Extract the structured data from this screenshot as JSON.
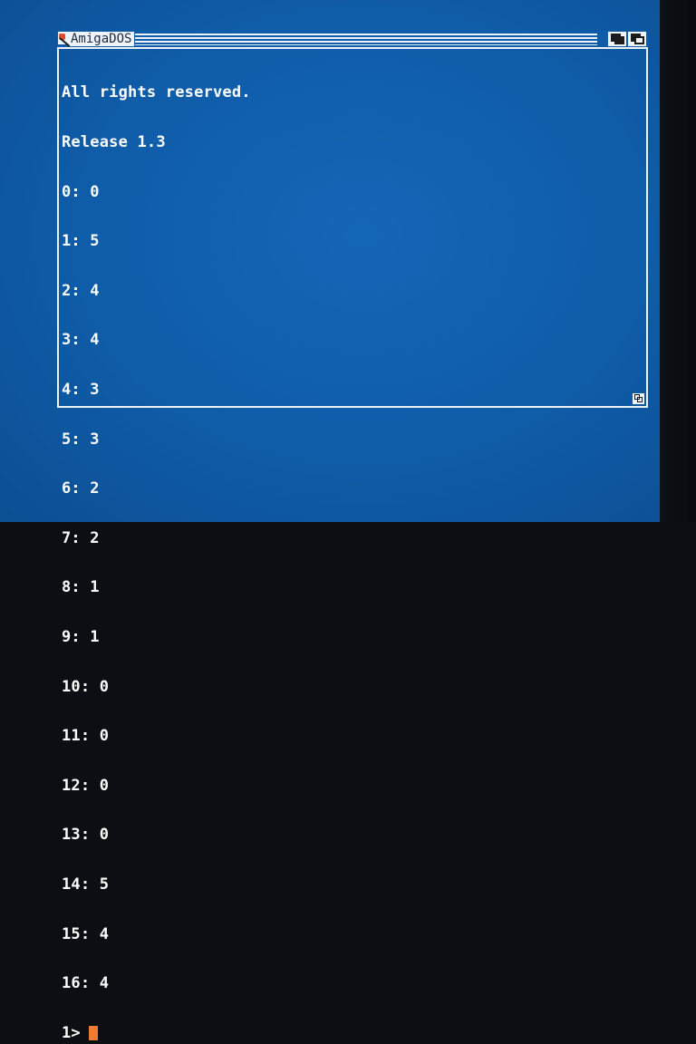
{
  "window": {
    "title": "AmigaDOS"
  },
  "console": {
    "lines": [
      "All rights reserved.",
      "Release 1.3",
      "0: 0",
      "1: 5",
      "2: 4",
      "3: 4",
      "4: 3",
      "5: 3",
      "6: 2",
      "7: 2",
      "8: 1",
      "9: 1",
      "10: 0",
      "11: 0",
      "12: 0",
      "13: 0",
      "14: 5",
      "15: 4",
      "16: 4"
    ],
    "prompt": "1>"
  },
  "colors": {
    "screen": "#0f5ca8",
    "text": "#ffffff",
    "chrome": "#eef3fb",
    "cursor": "#f07a2f",
    "close_gadget": "#e04a2b"
  },
  "icons": {
    "close": "close-gadget-icon",
    "depth_back": "depth-back-icon",
    "depth_front": "depth-front-icon",
    "resize": "resize-gadget-icon"
  }
}
